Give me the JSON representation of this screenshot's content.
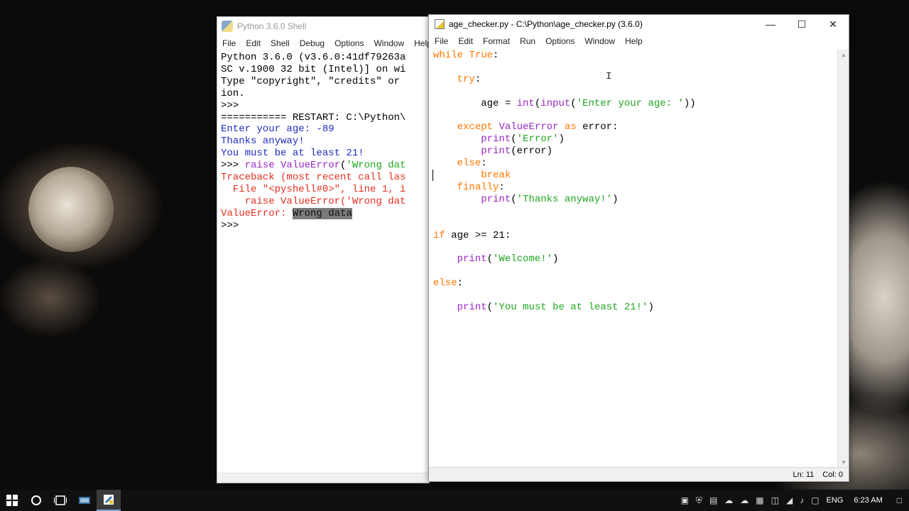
{
  "shell": {
    "title": "Python 3.6.0 Shell",
    "menu": [
      "File",
      "Edit",
      "Shell",
      "Debug",
      "Options",
      "Window",
      "Help"
    ]
  },
  "editor": {
    "title": "age_checker.py - C:\\Python\\age_checker.py (3.6.0)",
    "menu": [
      "File",
      "Edit",
      "Format",
      "Run",
      "Options",
      "Window",
      "Help"
    ],
    "status_ln": "Ln: 11",
    "status_col": "Col: 0"
  },
  "taskbar": {
    "lang": "ENG",
    "time": "6:23 AM"
  },
  "colors": {
    "keyword": "#ff7700",
    "builtin": "#9b27c1",
    "string": "#1fa61f",
    "stdout": "#1f2bbf",
    "stderr": "#e0301e"
  }
}
